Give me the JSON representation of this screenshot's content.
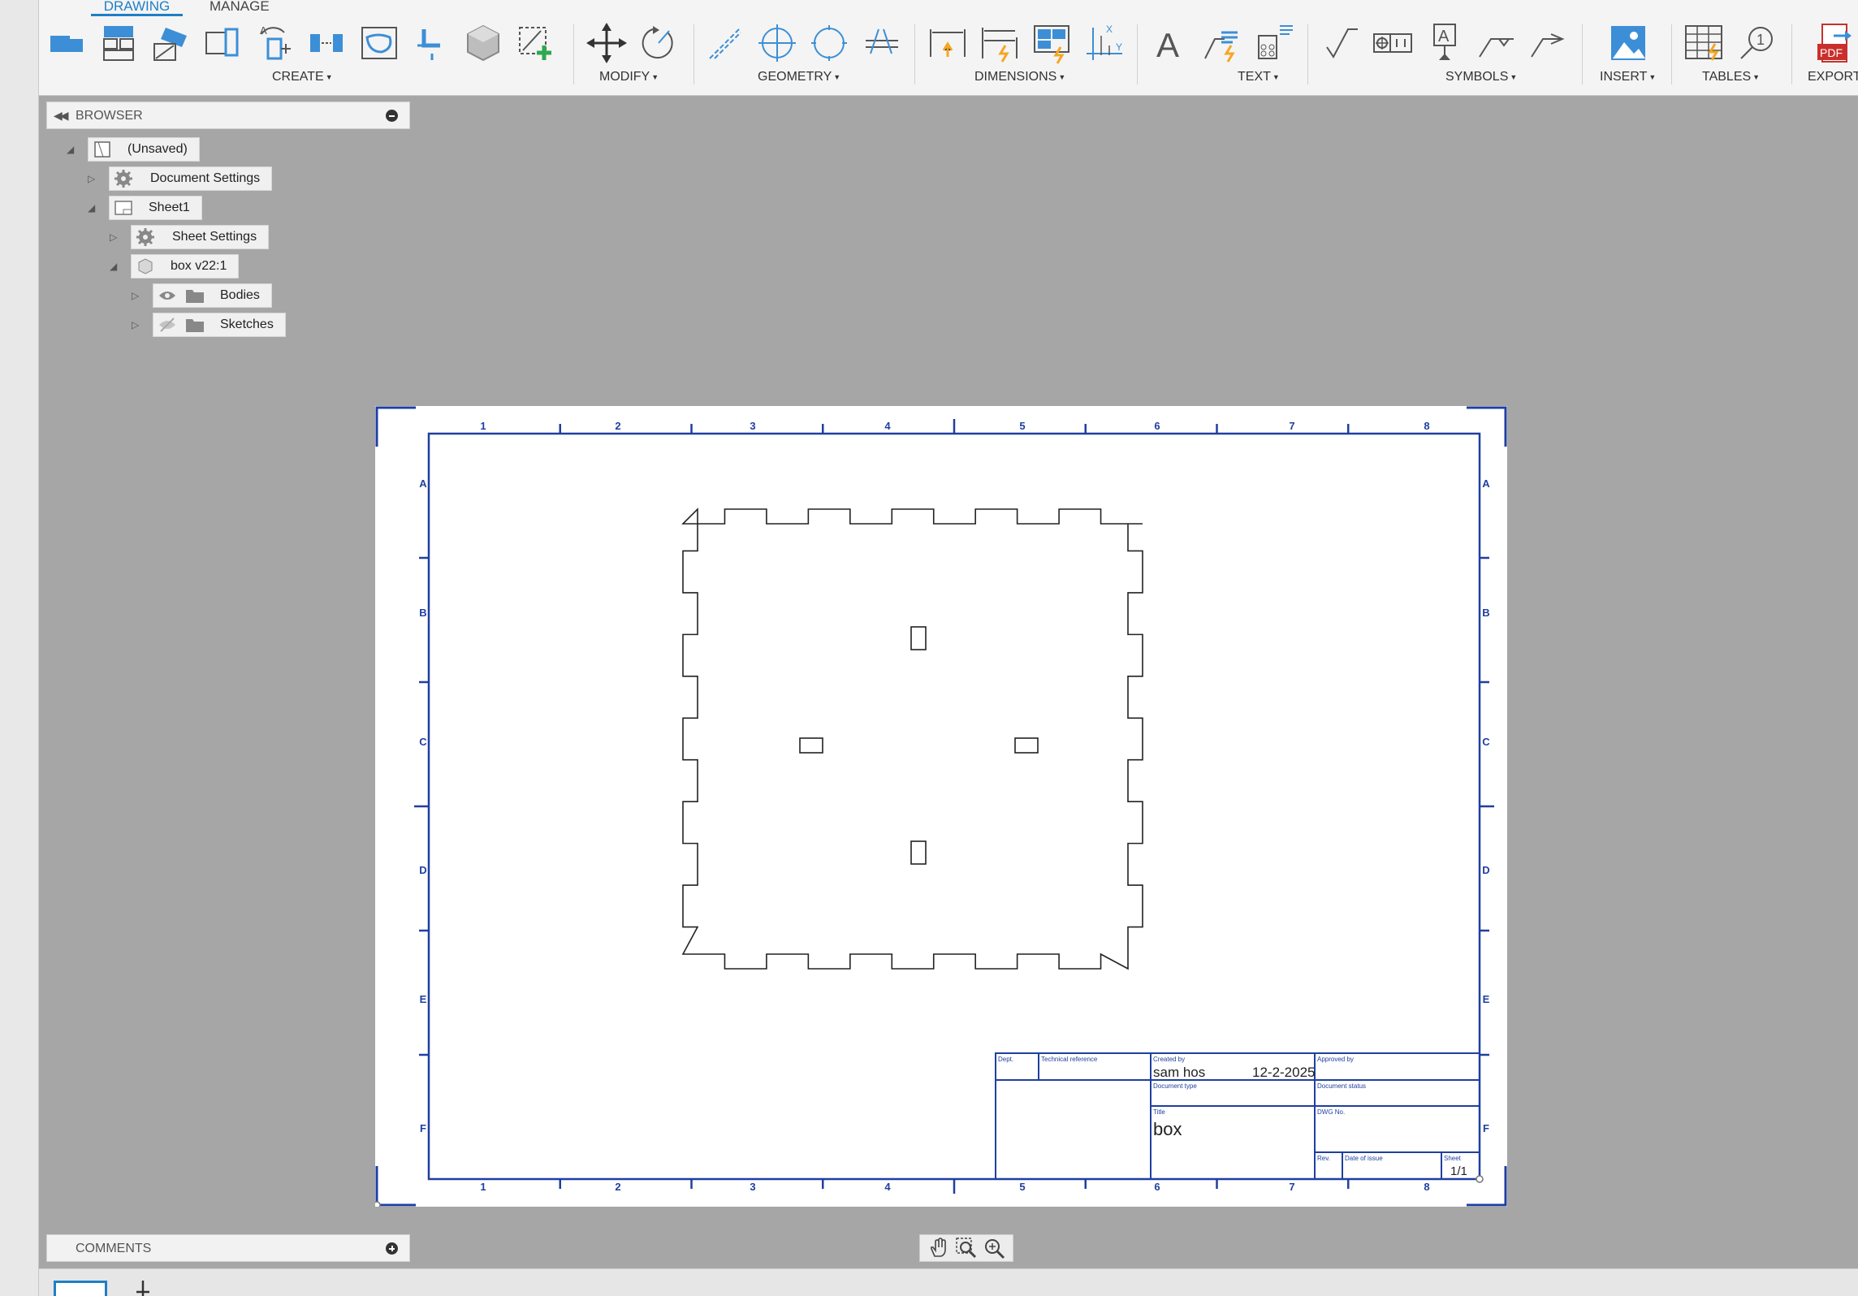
{
  "tabs": {
    "drawing": "DRAWING",
    "manage": "MANAGE"
  },
  "groups": {
    "create": "CREATE",
    "modify": "MODIFY",
    "geometry": "GEOMETRY",
    "dimensions": "DIMENSIONS",
    "text": "TEXT",
    "symbols": "SYMBOLS",
    "insert": "INSERT",
    "tables": "TABLES",
    "export": "EXPORT"
  },
  "tool_glyphs": {
    "text_tool": "A",
    "pdf_badge": "PDF",
    "balloon": "1",
    "axis_x": "X",
    "axis_y": "Y"
  },
  "browser": {
    "title": "BROWSER",
    "items": [
      {
        "label": "(Unsaved)"
      },
      {
        "label": "Document Settings"
      },
      {
        "label": "Sheet1"
      },
      {
        "label": "Sheet Settings"
      },
      {
        "label": "box v22:1"
      },
      {
        "label": "Bodies"
      },
      {
        "label": "Sketches"
      }
    ]
  },
  "comments": {
    "title": "COMMENTS"
  },
  "sheet": {
    "border_color": "#1f3fa0",
    "col_labels": [
      "1",
      "2",
      "3",
      "4",
      "5",
      "6",
      "7",
      "8"
    ],
    "row_labels": [
      "A",
      "B",
      "C",
      "D",
      "E",
      "F"
    ],
    "title_block": {
      "dept_label": "Dept.",
      "techref_label": "Technical reference",
      "created_by_label": "Created by",
      "created_by_value": "sam hos",
      "created_date": "12-2-2025",
      "approved_by_label": "Approved by",
      "doctype_label": "Document type",
      "docstatus_label": "Document status",
      "title_label": "Title",
      "title_value": "box",
      "dwg_label": "DWG No.",
      "rev_label": "Rev.",
      "issue_label": "Date of issue",
      "sheet_label": "Sheet",
      "sheet_value": "1/1"
    }
  },
  "colors": {
    "accent": "#1e7fc4",
    "sheet_blue": "#1f3fa0",
    "canvas": "#a6a6a6",
    "highlight_orange": "#f5a623",
    "highlight_green": "#2fa84f"
  }
}
